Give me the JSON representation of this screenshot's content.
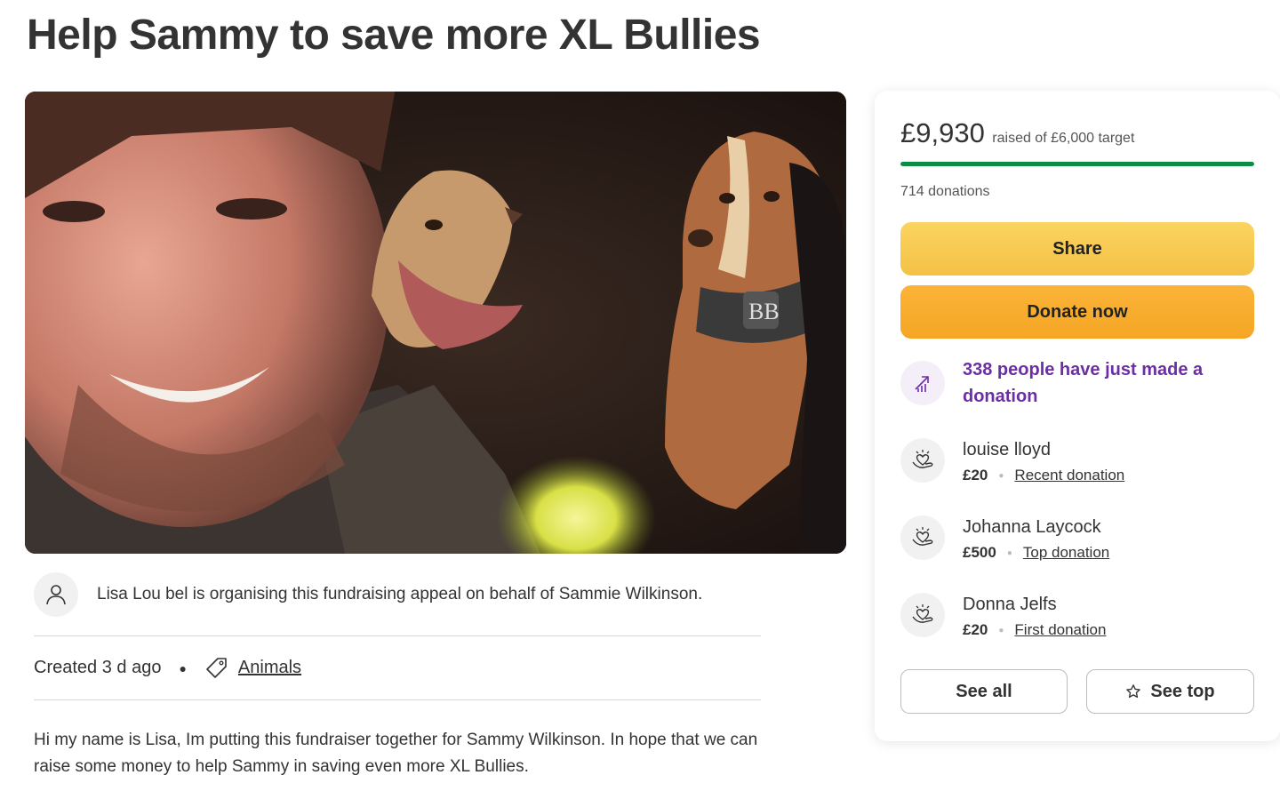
{
  "page": {
    "title": "Help Sammy to save more XL Bullies"
  },
  "organiser": {
    "text": "Lisa Lou bel is organising this fundraising appeal on behalf of Sammie Wilkinson."
  },
  "meta": {
    "created": "Created 3 d ago",
    "category": "Animals"
  },
  "story": {
    "text": "Hi my name is Lisa, Im putting this fundraiser together for Sammy Wilkinson. In hope that we can raise some money to help Sammy in saving even more XL Bullies."
  },
  "donation_panel": {
    "raised": "£9,930",
    "target_text": "raised of £6,000 target",
    "progress_fraction": 1.0,
    "donations_count": "714 donations",
    "share_label": "Share",
    "donate_label": "Donate now",
    "recent_activity": "338 people have just made a donation",
    "donors": [
      {
        "name": "louise lloyd",
        "amount": "£20",
        "label": "Recent donation"
      },
      {
        "name": "Johanna Laycock",
        "amount": "£500",
        "label": "Top donation"
      },
      {
        "name": "Donna Jelfs",
        "amount": "£20",
        "label": "First donation"
      }
    ],
    "see_all_label": "See all",
    "see_top_label": "See top"
  },
  "colors": {
    "progress": "#0a8c44",
    "share_button": "#f4c145",
    "donate_button": "#f5a623",
    "activity_text": "#6b2fa3"
  },
  "icons": [
    "trending-up-icon",
    "user-icon",
    "tag-icon",
    "heart-hand-icon",
    "star-icon"
  ]
}
